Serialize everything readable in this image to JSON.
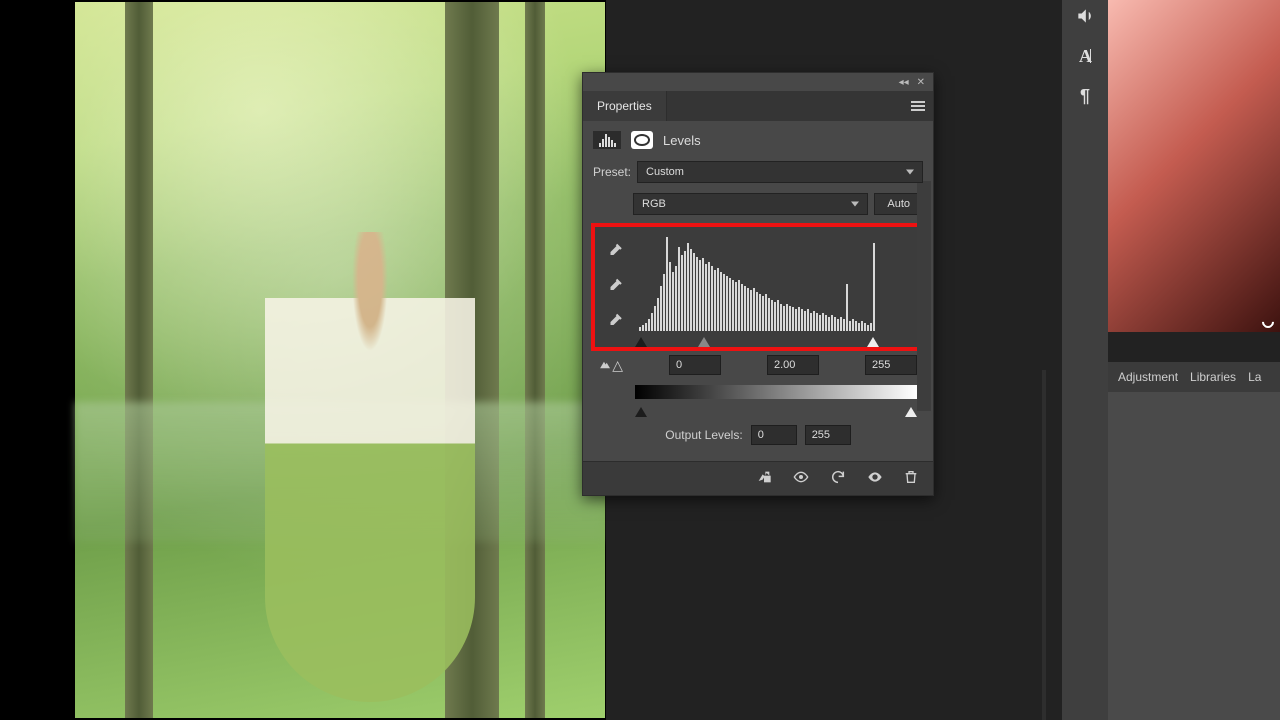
{
  "panel": {
    "title": "Properties",
    "adjustment_name": "Levels",
    "preset_label": "Preset:",
    "preset_value": "Custom",
    "channel_value": "RGB",
    "auto_label": "Auto",
    "input_levels": {
      "black": "0",
      "mid": "2.00",
      "white": "255"
    },
    "output_label": "Output Levels:",
    "output_levels": {
      "black": "0",
      "white": "255"
    }
  },
  "right_tabs": {
    "tab1": "Adjustment",
    "tab2": "Libraries",
    "tab3": "La"
  },
  "rail": {
    "sound_title": "adjustments",
    "char_title": "character",
    "para_title": "paragraph"
  }
}
